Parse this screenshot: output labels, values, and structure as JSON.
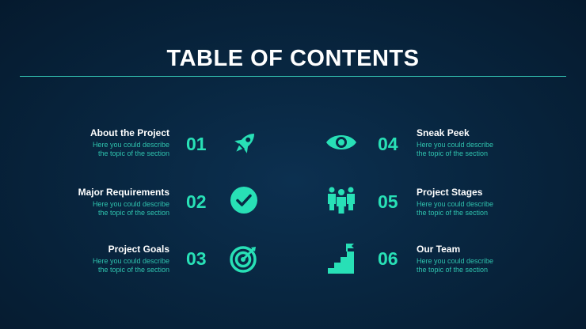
{
  "title": "TABLE OF CONTENTS",
  "accent_color": "#28e0b6",
  "items": [
    {
      "number": "01",
      "heading": "About the Project",
      "desc1": "Here you could describe",
      "desc2": "the topic of the section",
      "icon": "rocket-icon"
    },
    {
      "number": "02",
      "heading": "Major Requirements",
      "desc1": "Here you could describe",
      "desc2": "the topic of the section",
      "icon": "checkmark-circle-icon"
    },
    {
      "number": "03",
      "heading": "Project Goals",
      "desc1": "Here you could describe",
      "desc2": "the topic of the section",
      "icon": "target-icon"
    },
    {
      "number": "04",
      "heading": "Sneak Peek",
      "desc1": "Here you could describe",
      "desc2": "the topic of the section",
      "icon": "eye-icon"
    },
    {
      "number": "05",
      "heading": "Project Stages",
      "desc1": "Here you could describe",
      "desc2": "the topic of the section",
      "icon": "team-icon"
    },
    {
      "number": "06",
      "heading": "Our Team",
      "desc1": "Here you could describe",
      "desc2": "the topic of the section",
      "icon": "stairs-flag-icon"
    }
  ]
}
